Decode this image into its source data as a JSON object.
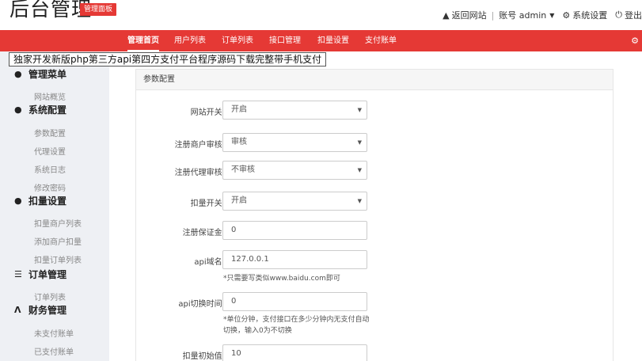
{
  "header": {
    "logo": "后台管理",
    "badge": "管理面板",
    "links": {
      "back_site": "返回网站",
      "account": "账号 admin",
      "settings": "系统设置",
      "logout": "登出"
    },
    "icons": {
      "home": "home-icon",
      "caret": "caret-down-icon",
      "settings": "gear-icon",
      "logout": "power-icon"
    }
  },
  "nav": {
    "items": [
      {
        "label": "管理首页",
        "active": true
      },
      {
        "label": "用户列表",
        "active": false
      },
      {
        "label": "订单列表",
        "active": false
      },
      {
        "label": "接口管理",
        "active": false
      },
      {
        "label": "扣量设置",
        "active": false
      },
      {
        "label": "支付账单",
        "active": false
      }
    ],
    "color": "#e53935"
  },
  "banner": "独家开发新版php第三方api第四方支付平台程序源码下载完整带手机支付",
  "sidebar": {
    "groups": [
      {
        "title": "管理菜单",
        "icon": "user-icon",
        "items": [
          "网站概览"
        ]
      },
      {
        "title": "系统配置",
        "icon": "user-icon",
        "items": [
          "参数配置",
          "代理设置",
          "系统日志",
          "修改密码"
        ]
      },
      {
        "title": "扣量设置",
        "icon": "user-icon",
        "items": [
          "扣量商户列表",
          "添加商户扣量",
          "扣量订单列表"
        ]
      },
      {
        "title": "订单管理",
        "icon": "list-icon",
        "items": [
          "订单列表"
        ]
      },
      {
        "title": "财务管理",
        "icon": "finance-icon",
        "items": [
          "未支付账单",
          "已支付账单"
        ]
      }
    ]
  },
  "panel": {
    "title": "参数配置",
    "fields": [
      {
        "label": "网站开关:",
        "type": "select",
        "value": "开启"
      },
      {
        "label": "注册商户审核:",
        "type": "select",
        "value": "审核"
      },
      {
        "label": "注册代理审核:",
        "type": "select",
        "value": "不审核"
      },
      {
        "label": "扣量开关:",
        "type": "select",
        "value": "开启"
      },
      {
        "label": "注册保证金:",
        "type": "input",
        "value": "0"
      },
      {
        "label": "api域名:",
        "type": "input",
        "value": "127.0.0.1",
        "hint": "*只需要写类似www.baidu.com即可"
      },
      {
        "label": "api切换时间:",
        "type": "input",
        "value": "0",
        "hint": "*单位分钟，支付接口在多少分钟内无支付自动切换，输入0为不切换"
      },
      {
        "label": "扣量初始值:",
        "type": "input",
        "value": "10"
      }
    ]
  }
}
